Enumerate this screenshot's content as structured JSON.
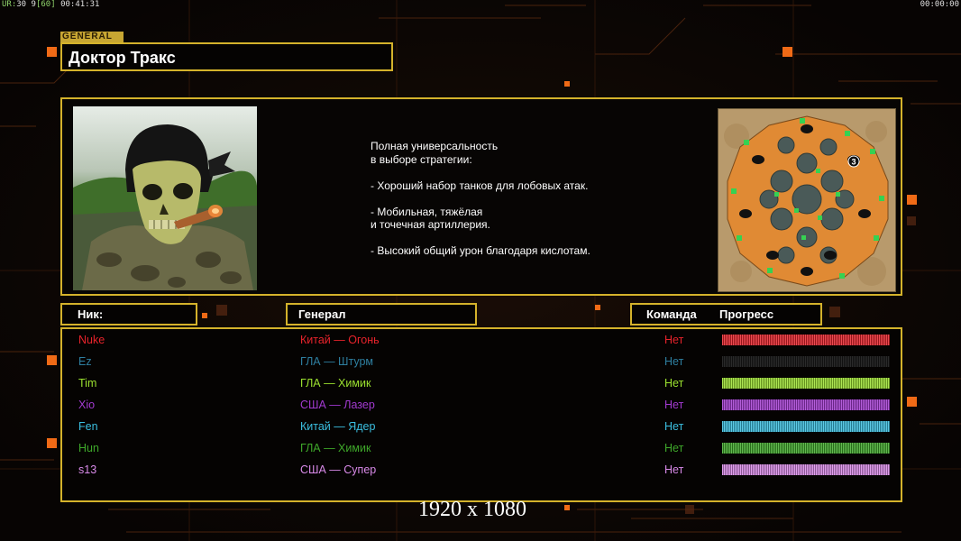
{
  "hud": {
    "left_label": "UR:",
    "left_values": "30 9",
    "left_bracket": "[60]",
    "left_time": "00:41:31",
    "right_time": "00:00:00"
  },
  "general": {
    "tag": "GENERAL",
    "name": "Доктор Тракс"
  },
  "description": [
    "Полная универсальность",
    "в выборе стратегии:",
    "",
    "- Хороший набор танков для лобовых атак.",
    "",
    "- Мобильная, тяжёлая",
    "и точечная артиллерия.",
    "",
    "- Высокий общий урон благодаря кислотам."
  ],
  "minimap": {
    "player_marker": "3"
  },
  "headers": {
    "nick": "Ник:",
    "general": "Генерал",
    "team": "Команда",
    "progress": "Прогресс"
  },
  "players": [
    {
      "nick": "Nuke",
      "general": "Китай — Огонь",
      "team": "Нет",
      "color": "#e8232b",
      "progress": 1.0
    },
    {
      "nick": "Ez",
      "general": "ГЛА — Штурм",
      "team": "Нет",
      "color": "#2e7fa0",
      "progress": 0.0
    },
    {
      "nick": "Tim",
      "general": "ГЛА — Химик",
      "team": "Нет",
      "color": "#9be12f",
      "progress": 1.0
    },
    {
      "nick": "Xio",
      "general": "США — Лазер",
      "team": "Нет",
      "color": "#a23ad1",
      "progress": 1.0
    },
    {
      "nick": "Fen",
      "general": "Китай — Ядер",
      "team": "Нет",
      "color": "#3bbfe0",
      "progress": 1.0
    },
    {
      "nick": "Hun",
      "general": "ГЛА — Химик",
      "team": "Нет",
      "color": "#3fa82a",
      "progress": 1.0
    },
    {
      "nick": "s13",
      "general": "США — Супер",
      "team": "Нет",
      "color": "#d98ae8",
      "progress": 1.0
    }
  ],
  "resolution_label": "1920 x 1080"
}
